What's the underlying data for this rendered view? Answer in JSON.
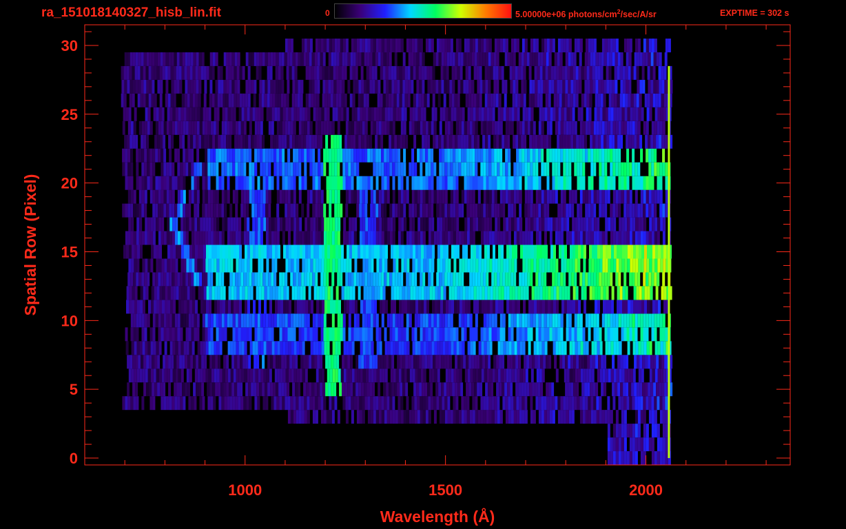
{
  "header": {
    "filename": "ra_151018140327_hisb_lin.fit",
    "colorbar_min": "0",
    "colorbar_max_value": "5.00000e+06 photons/cm",
    "colorbar_max_sup": "2",
    "colorbar_max_unit_rest": "/sec/A/sr",
    "exptime": "EXPTIME = 302 s"
  },
  "colors": {
    "axis": "#ff2a1a",
    "text": "#ff2a1a",
    "background": "#000000",
    "colormap": [
      "#000000",
      "#3a0078",
      "#2020ff",
      "#00d8ff",
      "#00ff60",
      "#d0ff00",
      "#ff7a00",
      "#ff1010"
    ]
  },
  "chart_data": {
    "type": "heatmap",
    "title": "",
    "xlabel": "Wavelength (Å)",
    "ylabel": "Spatial Row (Pixel)",
    "xlim": [
      600,
      2360
    ],
    "ylim": [
      -0.5,
      31.5
    ],
    "x_ticks": [
      1000,
      1500,
      2000
    ],
    "x_tick_labels": [
      "1000",
      "1500",
      "2000"
    ],
    "y_ticks": [
      0,
      5,
      10,
      15,
      20,
      25,
      30
    ],
    "y_tick_labels": [
      "0",
      "5",
      "10",
      "15",
      "20",
      "25",
      "30"
    ],
    "value_range": [
      0,
      5000000
    ],
    "detector_x_range": [
      780,
      2060
    ],
    "emission_features": [
      {
        "wavelength": 1216,
        "rows": [
          5,
          23
        ],
        "level": 0.55
      },
      {
        "wavelength": 1026,
        "rows": [
          7,
          22
        ],
        "level": 0.32
      },
      {
        "wavelength": 1304,
        "rows": [
          7,
          21
        ],
        "level": 0.3
      }
    ],
    "bright_bands": [
      {
        "rows": [
          8,
          10
        ],
        "level": 0.4
      },
      {
        "rows": [
          12,
          15
        ],
        "level": 0.55
      },
      {
        "rows": [
          20,
          22
        ],
        "level": 0.45
      }
    ]
  }
}
